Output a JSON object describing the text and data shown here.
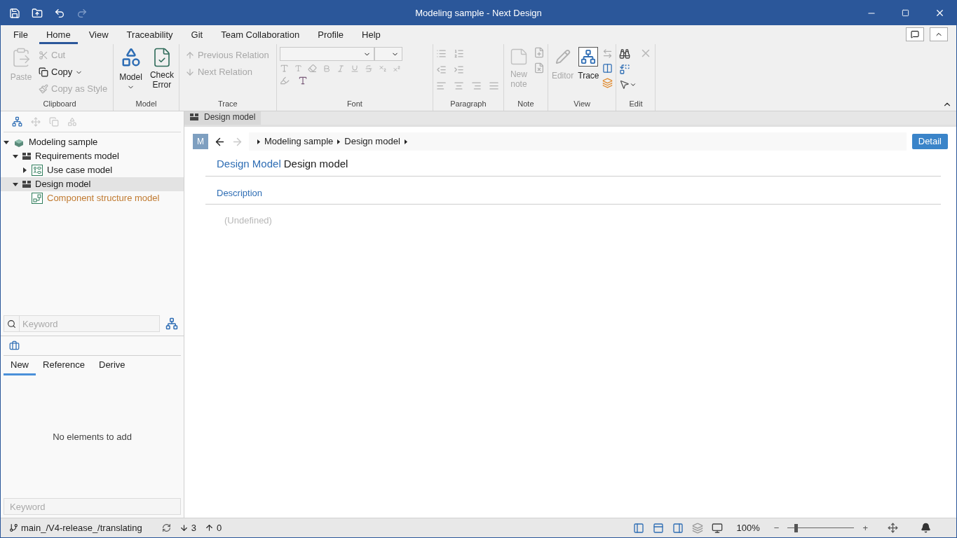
{
  "window": {
    "title": "Modeling sample - Next Design"
  },
  "menu_tabs": [
    {
      "label": "File",
      "selected": false
    },
    {
      "label": "Home",
      "selected": true
    },
    {
      "label": "View",
      "selected": false
    },
    {
      "label": "Traceability",
      "selected": false
    },
    {
      "label": "Git",
      "selected": false
    },
    {
      "label": "Team Collaboration",
      "selected": false
    },
    {
      "label": "Profile",
      "selected": false
    },
    {
      "label": "Help",
      "selected": false
    }
  ],
  "ribbon": {
    "clipboard": {
      "label": "Clipboard",
      "paste": {
        "label": "Paste",
        "disabled": true
      },
      "cut": {
        "label": "Cut",
        "disabled": true
      },
      "copy": {
        "label": "Copy",
        "disabled": false
      },
      "copy_as_style": {
        "label": "Copy as Style",
        "disabled": true
      }
    },
    "model": {
      "label": "Model",
      "model": {
        "label": "Model",
        "disabled": false
      },
      "check_error": {
        "label": "Check Error",
        "disabled": false
      }
    },
    "trace": {
      "label": "Trace",
      "previous": {
        "label": "Previous Relation",
        "disabled": true
      },
      "next": {
        "label": "Next Relation",
        "disabled": true
      }
    },
    "font": {
      "label": "Font"
    },
    "paragraph": {
      "label": "Paragraph"
    },
    "note": {
      "label": "Note",
      "new_note": {
        "label": "New note",
        "disabled": true
      }
    },
    "view": {
      "label": "View",
      "editor": {
        "label": "Editor",
        "disabled": true,
        "selected": false
      },
      "trace": {
        "label": "Trace",
        "disabled": false,
        "selected": true
      }
    },
    "edit": {
      "label": "Edit"
    }
  },
  "tree": [
    {
      "label": "Modeling sample",
      "kind": "project",
      "expanded": true,
      "selected": false,
      "color": "#1a1a1a",
      "children": [
        {
          "label": "Requirements model",
          "kind": "package",
          "expanded": true,
          "selected": false,
          "color": "#1a1a1a",
          "children": [
            {
              "label": "Use case model",
              "kind": "usecase",
              "expanded": false,
              "selected": false,
              "color": "#1a1a1a"
            }
          ]
        },
        {
          "label": "Design model",
          "kind": "package",
          "expanded": true,
          "selected": true,
          "color": "#1a1a1a",
          "children": [
            {
              "label": "Component structure model",
              "kind": "component",
              "selected": false,
              "color": "#c07a30"
            }
          ]
        }
      ]
    }
  ],
  "tree_search": {
    "placeholder": "Keyword"
  },
  "palette": {
    "tabs": [
      {
        "label": "New",
        "selected": true
      },
      {
        "label": "Reference",
        "selected": false
      },
      {
        "label": "Derive",
        "selected": false
      }
    ],
    "empty_message": "No elements to add",
    "search": {
      "placeholder": "Keyword"
    }
  },
  "editor": {
    "tab": "Design model",
    "badge": "M",
    "breadcrumbs": [
      "Modeling sample",
      "Design model"
    ],
    "detail_button": "Detail",
    "type_label": "Design Model",
    "name": "Design model",
    "section": "Description",
    "value": "(Undefined)"
  },
  "status_bar": {
    "branch": "main_/V4-release_/translating",
    "incoming": "3",
    "outgoing": "0",
    "zoom": "100%",
    "zoom_out": "−",
    "zoom_in": "+",
    "zoom_level": {
      "level": 0.12
    }
  }
}
